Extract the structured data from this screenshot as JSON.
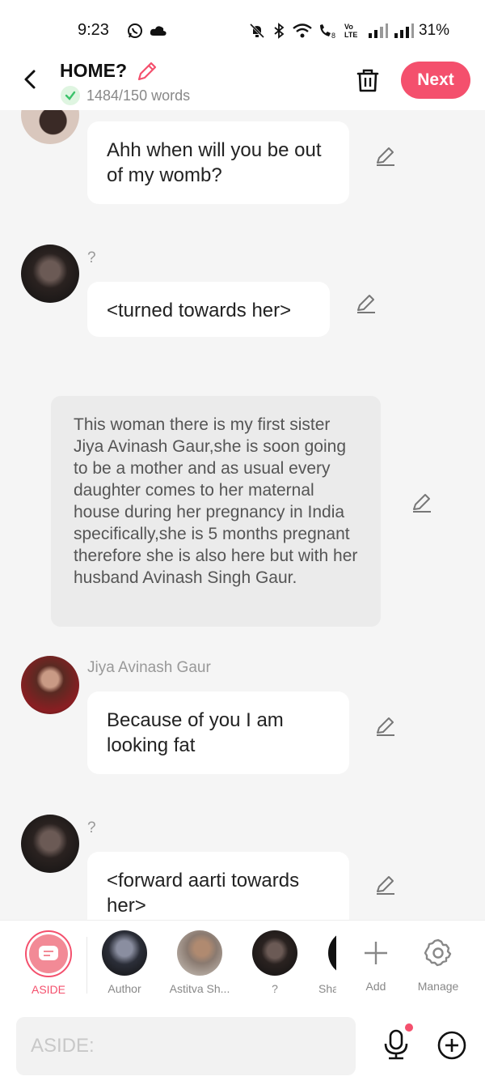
{
  "status": {
    "time": "9:23",
    "network_label": "Vo LTE",
    "battery": "31%",
    "icons": [
      "whatsapp-icon",
      "cloud-icon",
      "mute-icon",
      "bluetooth-icon",
      "wifi-icon",
      "wifi-call-icon",
      "signal-icon",
      "signal-icon",
      "battery-text"
    ]
  },
  "header": {
    "title": "HOME?",
    "word_count": "1484/150 words",
    "next_label": "Next"
  },
  "messages": [
    {
      "type": "bubble",
      "speaker": "",
      "text": "Ahh when will you be out of my womb?"
    },
    {
      "type": "bubble",
      "speaker": "?",
      "text": "<turned towards her>"
    },
    {
      "type": "narration",
      "text": "This woman there is my first sister Jiya Avinash Gaur,she is soon going to be a mother and as usual every daughter comes to her maternal house during her pregnancy in India specifically,she is 5 months pregnant therefore she is also here but with her husband Avinash Singh Gaur."
    },
    {
      "type": "bubble",
      "speaker": "Jiya Avinash Gaur",
      "text": "Because of you I am looking fat"
    },
    {
      "type": "bubble",
      "speaker": "?",
      "text": "<forward aarti towards her>"
    }
  ],
  "characters": [
    {
      "label": "ASIDE",
      "active": true
    },
    {
      "label": "Author"
    },
    {
      "label": "Astitva Sh..."
    },
    {
      "label": "?"
    },
    {
      "label": "Sha"
    }
  ],
  "actions": {
    "add_label": "Add",
    "manage_label": "Manage"
  },
  "input": {
    "placeholder": "ASIDE:"
  },
  "colors": {
    "accent": "#f4506d",
    "check_green": "#3cc36b"
  }
}
